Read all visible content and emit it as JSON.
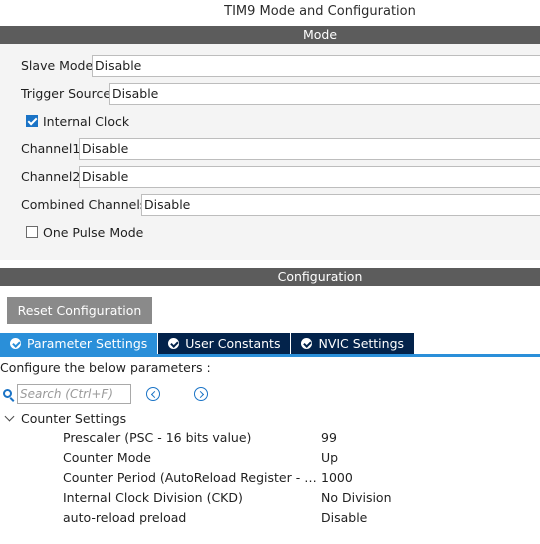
{
  "window_title": "TIM9 Mode and Configuration",
  "mode_section": {
    "title": "Mode",
    "slave_mode": {
      "label": "Slave Mode",
      "value": "Disable"
    },
    "trigger_source": {
      "label": "Trigger Source",
      "value": "Disable"
    },
    "internal_clock": {
      "label": "Internal Clock",
      "checked": true
    },
    "channel1": {
      "label": "Channel1",
      "value": "Disable"
    },
    "channel2": {
      "label": "Channel2",
      "value": "Disable"
    },
    "combined_channels": {
      "label": "Combined Channels",
      "value": "Disable"
    },
    "one_pulse_mode": {
      "label": "One Pulse Mode",
      "checked": false
    }
  },
  "config_section": {
    "title": "Configuration",
    "reset_button": "Reset Configuration",
    "tabs": [
      {
        "label": "Parameter Settings",
        "active": true
      },
      {
        "label": "User Constants",
        "active": false
      },
      {
        "label": "NVIC Settings",
        "active": false
      }
    ],
    "configure_text": "Configure the below parameters :",
    "search_placeholder": "Search (Ctrl+F)",
    "group_label": "Counter Settings",
    "params": [
      {
        "name": "Prescaler (PSC - 16 bits value)",
        "value": "99"
      },
      {
        "name": "Counter Mode",
        "value": "Up"
      },
      {
        "name": "Counter Period (AutoReload Register - 16 ...",
        "value": "1000"
      },
      {
        "name": "Internal Clock Division (CKD)",
        "value": "No Division"
      },
      {
        "name": "auto-reload preload",
        "value": "Disable"
      }
    ]
  },
  "colors": {
    "section_bar": "#5c5c5c",
    "tab_active": "#2a8fd9",
    "tab_inactive": "#03234b",
    "accent": "#1a73c6"
  }
}
